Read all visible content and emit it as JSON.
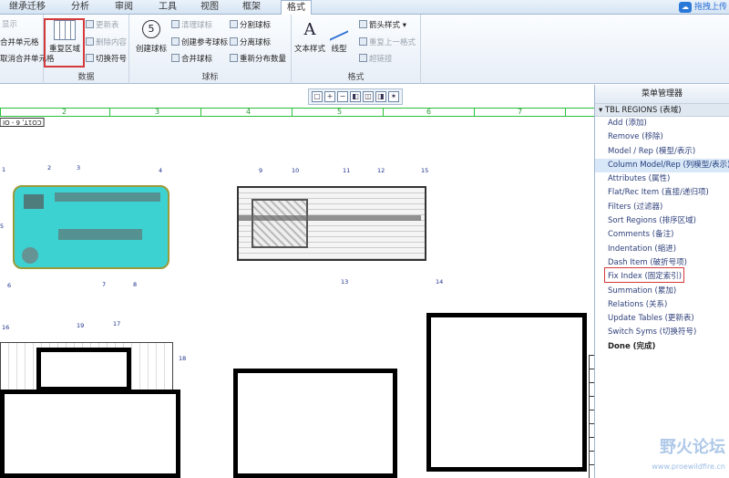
{
  "tabs": [
    "继承迁移",
    "分析",
    "审阅",
    "工具",
    "视图",
    "框架",
    "格式"
  ],
  "upload": "拖拽上传",
  "ribbon": {
    "left_items": [
      "显示",
      "合并单元格",
      "取消合并单元格"
    ],
    "repeat_region": "重复区域",
    "data_group_items": [
      "更新表",
      "删除内容",
      "切换符号"
    ],
    "data_group_label": "数据",
    "balloon_create": "创建球标",
    "balloon_items": [
      "清理球标",
      "创建参考球标",
      "合并球标"
    ],
    "balloon_items2": [
      "分割球标",
      "分离球标",
      "重新分布数量"
    ],
    "balloon_group_label": "球标",
    "text_style": "文本样式",
    "line_style": "线型",
    "arrow_style": "箭头样式",
    "repeat_style": "重复上一格式",
    "hyperlink": "超链接",
    "format_group_label": "格式"
  },
  "drawing": {
    "ruler_numbers": [
      "2",
      "3",
      "4",
      "5",
      "6",
      "7"
    ],
    "labels": [
      "1",
      "2",
      "3",
      "4",
      "5",
      "6",
      "7",
      "8",
      "9",
      "10",
      "11",
      "12",
      "13",
      "14",
      "15",
      "16",
      "17",
      "18",
      "19"
    ],
    "corner_label": "CO1T, 6 - OI"
  },
  "menu": {
    "title": "菜单管理器",
    "header": "TBL REGIONS (表域)",
    "items": [
      "Add (添加)",
      "Remove (移除)",
      "Model / Rep (模型/表示)",
      "Column Model/Rep (列模型/表示)",
      "Attributes (属性)",
      "Flat/Rec Item (直接/递归项)",
      "Filters (过滤器)",
      "Sort Regions (排序区域)",
      "Comments (备注)",
      "Indentation (缩进)",
      "Dash Item (破折号项)",
      "Fix Index (固定索引)",
      "Summation (累加)",
      "Relations (关系)",
      "Update Tables (更新表)",
      "Switch Syms (切换符号)",
      "Done (完成)"
    ]
  },
  "watermark": {
    "text": "野火论坛",
    "url": "www.proewildfire.cn"
  }
}
